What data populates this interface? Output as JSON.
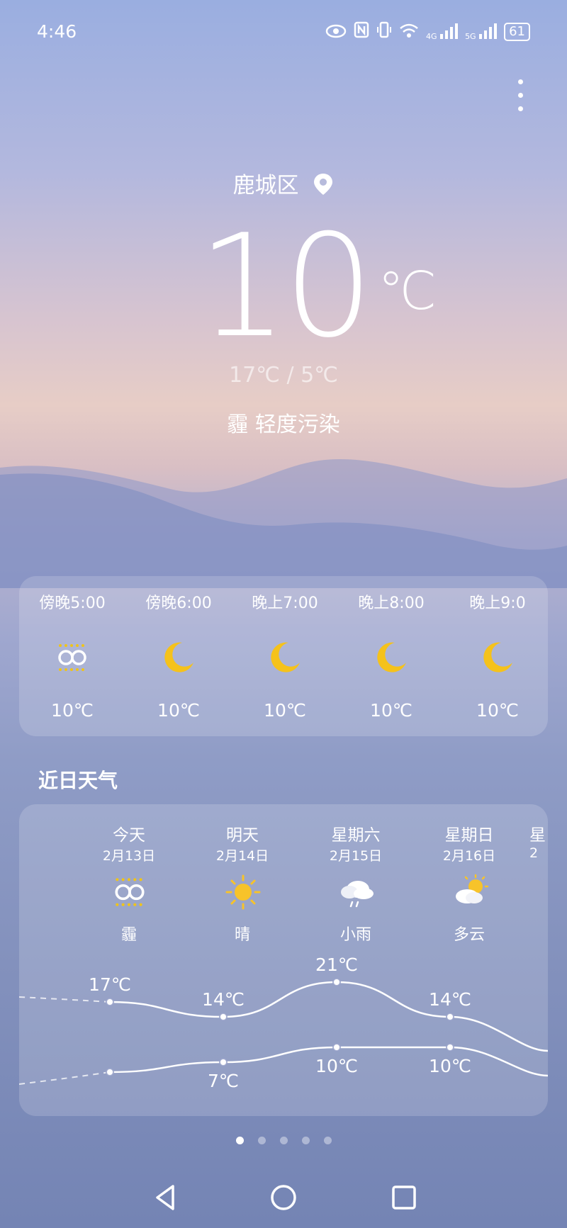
{
  "status_bar": {
    "time": "4:46",
    "signal_4g": "4G",
    "signal_5g": "5G",
    "battery": "61"
  },
  "location": {
    "name": "鹿城区"
  },
  "current": {
    "temp": "10",
    "unit": "℃",
    "hilo": "17℃ / 5℃",
    "air_quality": "霾  轻度污染"
  },
  "hourly": [
    {
      "time": "傍晚5:00",
      "icon": "haze-icon",
      "temp": "10℃"
    },
    {
      "time": "傍晚6:00",
      "icon": "moon-icon",
      "temp": "10℃"
    },
    {
      "time": "晚上7:00",
      "icon": "moon-icon",
      "temp": "10℃"
    },
    {
      "time": "晚上8:00",
      "icon": "moon-icon",
      "temp": "10℃"
    },
    {
      "time": "晚上9:0",
      "icon": "moon-icon",
      "temp": "10℃"
    }
  ],
  "section_title": "近日天气",
  "daily": [
    {
      "day": "今天",
      "date": "2月13日",
      "icon": "haze-icon",
      "weather": "霾",
      "high": "17℃",
      "low": ""
    },
    {
      "day": "明天",
      "date": "2月14日",
      "icon": "sun-icon",
      "weather": "晴",
      "high": "14℃",
      "low": "7℃"
    },
    {
      "day": "星期六",
      "date": "2月15日",
      "icon": "rain-icon",
      "weather": "小雨",
      "high": "21℃",
      "low": "10℃"
    },
    {
      "day": "星期日",
      "date": "2月16日",
      "icon": "partly-cloudy-icon",
      "weather": "多云",
      "high": "14℃",
      "low": "10℃"
    },
    {
      "day": "星",
      "date": "2",
      "icon": "",
      "weather": "",
      "high": "",
      "low": ""
    }
  ],
  "page_indicator": {
    "count": 5,
    "active": 1
  },
  "colors": {
    "moon": "#f5c21b",
    "sun": "#f7c32a",
    "haze_dots": "#f0c419"
  }
}
